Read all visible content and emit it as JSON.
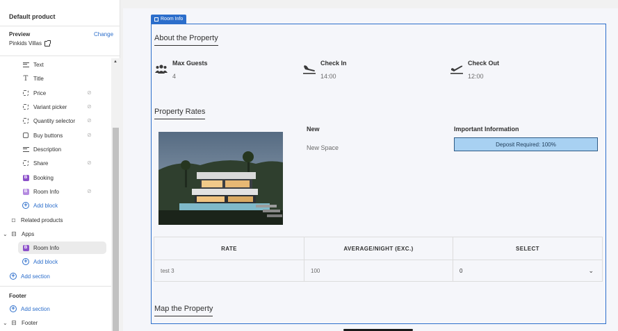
{
  "sidebar": {
    "title": "Default product",
    "preview_label": "Preview",
    "change_label": "Change",
    "preview_value": "Pinkids Villas",
    "items": [
      {
        "label": "Text"
      },
      {
        "label": "Title"
      },
      {
        "label": "Price"
      },
      {
        "label": "Variant picker"
      },
      {
        "label": "Quantity selector"
      },
      {
        "label": "Buy buttons"
      },
      {
        "label": "Description"
      },
      {
        "label": "Share"
      },
      {
        "label": "Booking"
      },
      {
        "label": "Room Info"
      },
      {
        "label": "Add block"
      },
      {
        "label": "Related products"
      },
      {
        "label": "Apps"
      },
      {
        "label": "Room Info"
      },
      {
        "label": "Add block"
      },
      {
        "label": "Add section"
      }
    ],
    "footer_label": "Footer",
    "footer_add_section": "Add section",
    "footer_item": "Footer"
  },
  "frame": {
    "tag_label": "Room Info"
  },
  "about": {
    "title": "About the Property",
    "features": [
      {
        "label": "Max Guests",
        "value": "4",
        "icon": "guests-icon"
      },
      {
        "label": "Check In",
        "value": "14:00",
        "icon": "plane-landing-icon"
      },
      {
        "label": "Check Out",
        "value": "12:00",
        "icon": "plane-departure-icon"
      }
    ]
  },
  "rates": {
    "title": "Property Rates",
    "name_heading": "New",
    "name_value": "New Space",
    "info_heading": "Important Information",
    "deposit_text": "Deposit Required: 100%",
    "table": {
      "headers": [
        "RATE",
        "AVERAGE/NIGHT (EXC.)",
        "SELECT"
      ],
      "row": [
        "test 3",
        "100",
        "0"
      ]
    }
  },
  "map": {
    "title": "Map the Property"
  },
  "colors": {
    "accent": "#2c6ecb",
    "deposit_bg": "#a8d1f2",
    "block_purple": "#8c50c9"
  }
}
